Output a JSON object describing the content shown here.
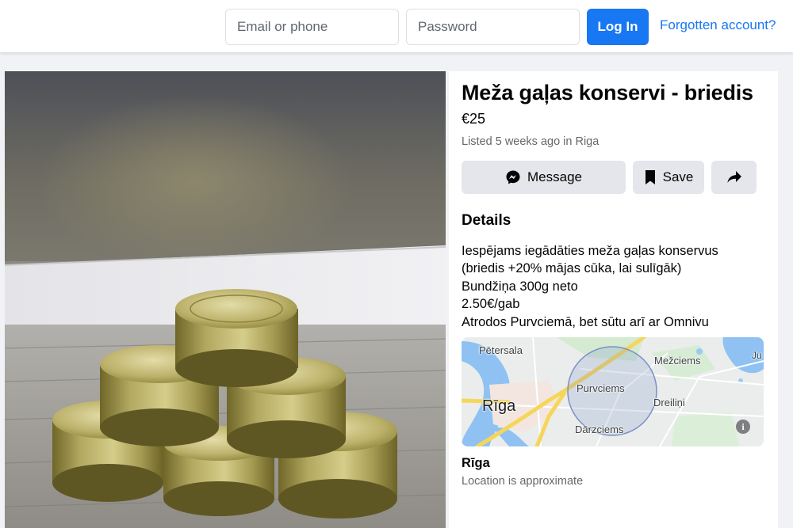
{
  "header": {
    "email_placeholder": "Email or phone",
    "password_placeholder": "Password",
    "login_label": "Log In",
    "forgot_label": "Forgotten account?",
    "accent": "#1877f2"
  },
  "listing": {
    "title": "Meža gaļas konservi - briedis",
    "price": "€25",
    "listed": "Listed 5 weeks ago in Riga",
    "actions": {
      "message_label": "Message",
      "message_icon": "messenger-icon",
      "save_label": "Save",
      "save_icon": "bookmark-icon",
      "share_icon": "share-arrow-icon"
    },
    "details_heading": "Details",
    "description": [
      "Iespējams iegādāties meža gaļas konservus",
      "(briedis +20% mājas cūka, lai sulīgāk)",
      "Bundžiņa 300g neto",
      "2.50€/gab",
      "Atrodos Purvciemā, bet sūtu arī ar Omnivu"
    ],
    "map": {
      "labels": {
        "petersala": "Pētersala",
        "mezciems": "Mežciems",
        "purvciems": "Purvciems",
        "riga": "Rīga",
        "dreilini": "Dreiliņi",
        "darzciems": "Dārzciems",
        "ju": "Ju"
      },
      "info_icon": "info-icon"
    },
    "location_name": "Rīga",
    "location_note": "Location is approximate"
  }
}
